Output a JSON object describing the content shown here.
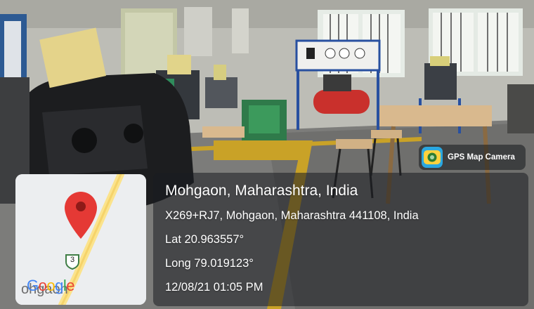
{
  "badge": {
    "label": "GPS Map Camera",
    "icon": "gps-map-camera-icon"
  },
  "map": {
    "town_label": "ohgaon",
    "route_number": "3",
    "logo_letters": [
      {
        "ch": "G",
        "color": "#4285F4"
      },
      {
        "ch": "o",
        "color": "#EA4335"
      },
      {
        "ch": "o",
        "color": "#FBBC05"
      },
      {
        "ch": "g",
        "color": "#4285F4"
      },
      {
        "ch": "l",
        "color": "#34A853"
      },
      {
        "ch": "e",
        "color": "#EA4335"
      }
    ],
    "pin_color": "#E53935"
  },
  "info": {
    "title": "Mohgaon, Maharashtra, India",
    "address": "X269+RJ7, Mohgaon, Maharashtra 441108, India",
    "latitude": "Lat 20.963557°",
    "longitude": "Long 79.019123°",
    "datetime": "12/08/21 01:05 PM"
  }
}
